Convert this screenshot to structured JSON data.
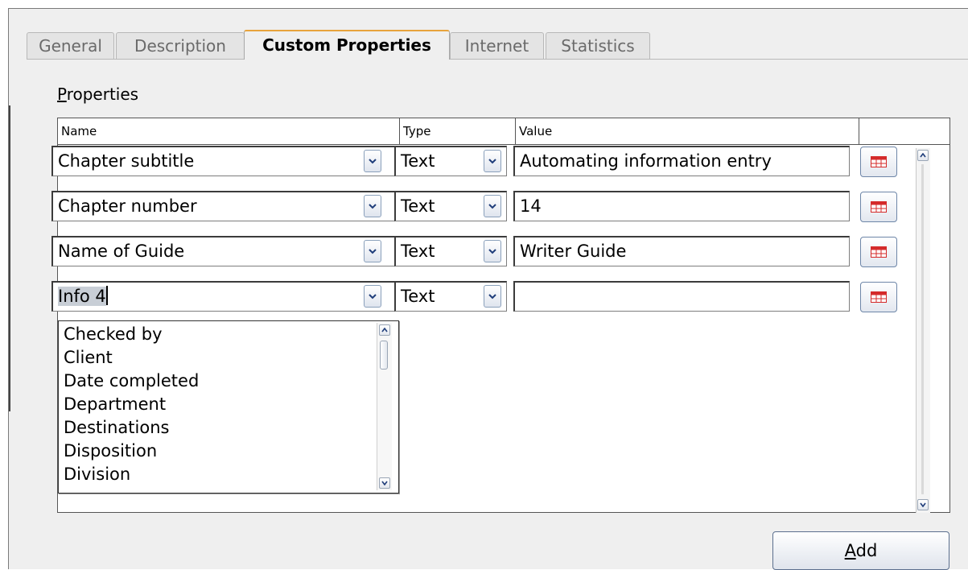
{
  "tabs": [
    {
      "label": "General",
      "active": false
    },
    {
      "label": "Description",
      "active": false
    },
    {
      "label": "Custom Properties",
      "active": true
    },
    {
      "label": "Internet",
      "active": false
    },
    {
      "label": "Statistics",
      "active": false
    }
  ],
  "properties": {
    "label_accel": "P",
    "label_rest": "roperties",
    "columns": {
      "name": "Name",
      "type": "Type",
      "value": "Value"
    },
    "rows": [
      {
        "name": "Chapter subtitle",
        "type": "Text",
        "value": "Automating information entry"
      },
      {
        "name": "Chapter number",
        "type": "Text",
        "value": "14"
      },
      {
        "name": "Name of Guide",
        "type": "Text",
        "value": "Writer Guide"
      },
      {
        "name": "Info 4",
        "type": "Text",
        "value": ""
      }
    ]
  },
  "name_dropdown_list": {
    "items": [
      "Checked by",
      "Client",
      "Date completed",
      "Department",
      "Destinations",
      "Disposition",
      "Division"
    ]
  },
  "buttons": {
    "add_accel": "A",
    "add_rest": "dd"
  },
  "colors": {
    "active_tab_accent": "#e8a33c",
    "button_border": "#6e86a8",
    "table_icon_red": "#d42a2a"
  }
}
